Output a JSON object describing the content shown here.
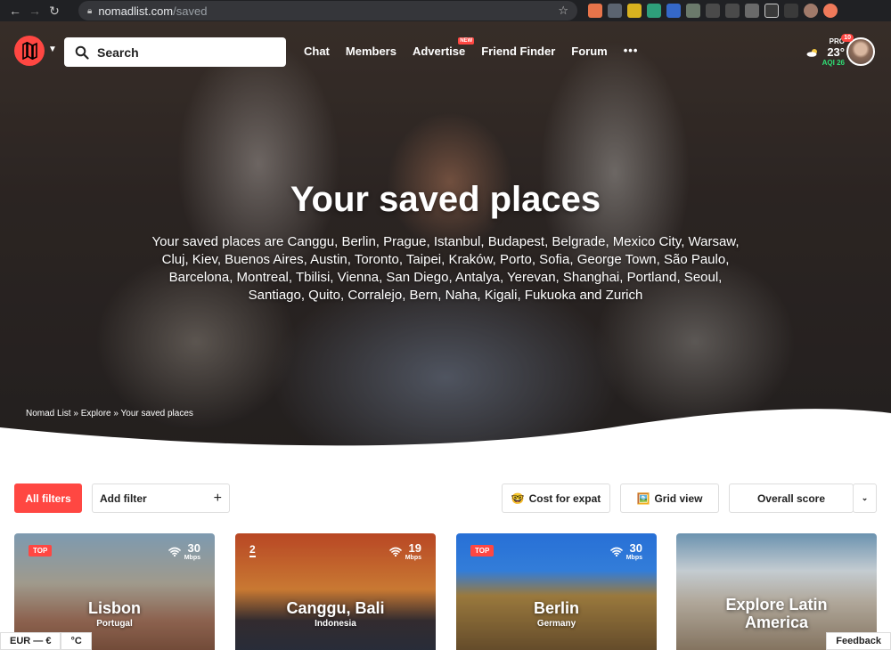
{
  "browser": {
    "url_domain": "nomadlist.com",
    "url_path": "/saved"
  },
  "header": {
    "search_placeholder": "Search",
    "nav": [
      {
        "label": "Chat"
      },
      {
        "label": "Members"
      },
      {
        "label": "Advertise",
        "badge": "NEW"
      },
      {
        "label": "Friend Finder"
      },
      {
        "label": "Forum"
      }
    ],
    "more": "•••",
    "weather": {
      "pro_label": "PRO",
      "temperature": "23°",
      "aqi": "AQI 26"
    },
    "notification_count": "10"
  },
  "hero": {
    "title": "Your saved places",
    "subtitle": "Your saved places are Canggu, Berlin, Prague, Istanbul, Budapest, Belgrade, Mexico City, Warsaw, Cluj, Kiev, Buenos Aires, Austin, Toronto, Taipei, Kraków, Porto, Sofia, George Town, São Paulo, Barcelona, Montreal, Tbilisi, Vienna, San Diego, Antalya, Yerevan, Shanghai, Portland, Seoul, Santiago, Quito, Corralejo, Bern, Naha, Kigali, Fukuoka and Zurich",
    "breadcrumb": "Nomad List » Explore » Your saved places"
  },
  "filters": {
    "all_filters": "All filters",
    "add_filter": "Add filter",
    "add_plus": "+",
    "cost_emoji": "🤓",
    "cost": "Cost for expat",
    "grid_emoji": "🖼️",
    "grid": "Grid view",
    "sort": "Overall score",
    "sort_caret": "⌄"
  },
  "cards": [
    {
      "badge": "TOP",
      "speed": "30",
      "unit": "Mbps",
      "city": "Lisbon",
      "country": "Portugal"
    },
    {
      "rank": "2",
      "speed": "19",
      "unit": "Mbps",
      "city": "Canggu, Bali",
      "country": "Indonesia"
    },
    {
      "badge": "TOP",
      "speed": "30",
      "unit": "Mbps",
      "city": "Berlin",
      "country": "Germany"
    },
    {
      "explore": "Explore Latin America"
    }
  ],
  "footer": {
    "currency": "EUR — €",
    "unit": "°C",
    "feedback": "Feedback"
  },
  "colors": {
    "accent": "#ff4742",
    "aqi_good": "#2fdf75"
  }
}
